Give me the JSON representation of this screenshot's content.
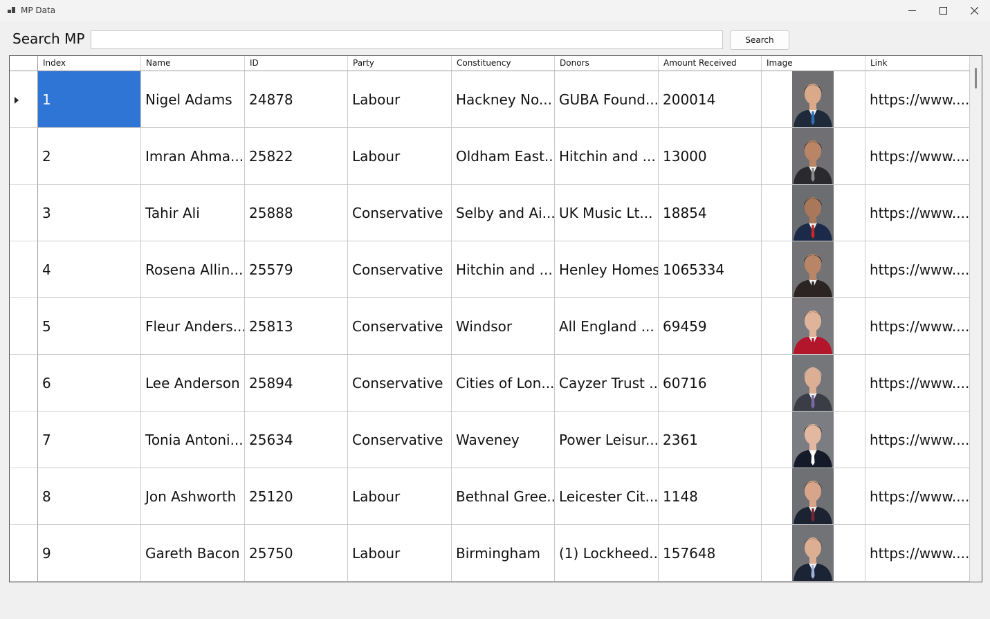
{
  "window": {
    "title": "MP Data"
  },
  "search": {
    "label": "Search MP",
    "value": "",
    "button_label": "Search"
  },
  "table": {
    "columns": [
      "Index",
      "Name",
      "ID",
      "Party",
      "Constituency",
      "Donors",
      "Amount Received",
      "Image",
      "Link"
    ],
    "rows": [
      [
        "1",
        "Nigel Adams",
        "24878",
        "Labour",
        "Hackney No...",
        "GUBA Found...",
        "200014",
        "",
        "https://www...."
      ],
      [
        "2",
        "Imran Ahma...",
        "25822",
        "Labour",
        "Oldham East...",
        "Hitchin and ...",
        "13000",
        "",
        "https://www...."
      ],
      [
        "3",
        "Tahir Ali",
        "25888",
        "Conservative",
        "Selby and Ai...",
        "UK Music Lt...",
        "18854",
        "",
        "https://www...."
      ],
      [
        "4",
        "Rosena Allin...",
        "25579",
        "Conservative",
        "Hitchin and ...",
        "Henley Homes",
        "1065334",
        "",
        "https://www...."
      ],
      [
        "5",
        "Fleur Anders...",
        "25813",
        "Conservative",
        "Windsor",
        "All England ...",
        "69459",
        "",
        "https://www...."
      ],
      [
        "6",
        "Lee Anderson",
        "25894",
        "Conservative",
        "Cities of Lon...",
        "Cayzer Trust ...",
        "60716",
        "",
        "https://www...."
      ],
      [
        "7",
        "Tonia Antoni...",
        "25634",
        "Conservative",
        "Waveney",
        "Power Leisur...",
        "2361",
        "",
        "https://www...."
      ],
      [
        "8",
        "Jon Ashworth",
        "25120",
        "Labour",
        "Bethnal Gree...",
        "Leicester Cit...",
        "1148",
        "",
        "https://www...."
      ],
      [
        "9",
        "Gareth Bacon",
        "25750",
        "Labour",
        "Birmingham",
        "(1) Lockheed...",
        "157648",
        "",
        "https://www...."
      ]
    ],
    "photo_styles": [
      {
        "bg": "#6f6f72",
        "skin": "#d9a98a",
        "hair": "#2a2320",
        "suit": "#1e2a3a",
        "tie": "#2f6db5"
      },
      {
        "bg": "#707074",
        "skin": "#b98565",
        "hair": "#1c1815",
        "suit": "#2a2a2e",
        "tie": "#8a8a8a"
      },
      {
        "bg": "#6c6d70",
        "skin": "#a9775a",
        "hair": "#1a1614",
        "suit": "#1c2a4a",
        "tie": "#c62828"
      },
      {
        "bg": "#737376",
        "skin": "#b88667",
        "hair": "#1e1712",
        "suit": "#2b2422",
        "tie": "#2b2422"
      },
      {
        "bg": "#7a7a7e",
        "skin": "#e0b49a",
        "hair": "#7a4a2e",
        "suit": "#b3152b",
        "tie": "#b3152b"
      },
      {
        "bg": "#75767a",
        "skin": "#dcae94",
        "hair": "#b8b8b8",
        "suit": "#3a3d45",
        "tie": "#7a6aa8"
      },
      {
        "bg": "#7c7d82",
        "skin": "#e2b8a0",
        "hair": "#2c2420",
        "suit": "#141a28",
        "tie": "#ffffff"
      },
      {
        "bg": "#6f7074",
        "skin": "#d8a58a",
        "hair": "#3a2a22",
        "suit": "#1b2332",
        "tie": "#7a2530"
      },
      {
        "bg": "#727377",
        "skin": "#dcae92",
        "hair": "#5a3a28",
        "suit": "#1b2435",
        "tie": "#9bb3d6"
      }
    ],
    "selected_row": 0,
    "accent_color": "#2f75d6"
  }
}
